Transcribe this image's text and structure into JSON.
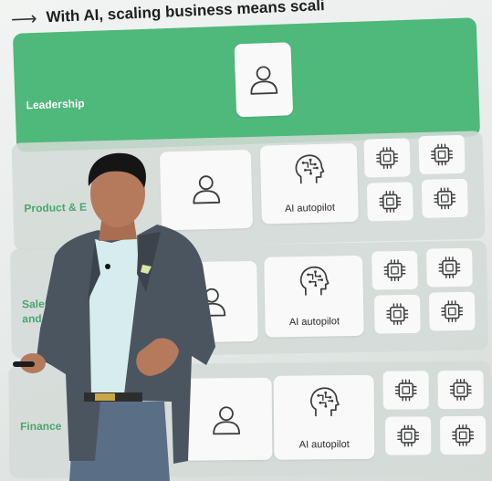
{
  "slide": {
    "headline": "With AI, scaling business means scali",
    "arrow_glyph": "⟶",
    "rows": [
      {
        "label": "Leadership"
      },
      {
        "label": "Product & E"
      },
      {
        "label_line1": "Sales",
        "label_line2": "and r"
      },
      {
        "label": "Finance"
      }
    ],
    "ai_label": "AI autopilot"
  },
  "icons": {
    "person": "person-outline-icon",
    "brain": "brain-circuit-icon",
    "chip": "microchip-icon"
  },
  "colors": {
    "accent_green": "#4fb87b",
    "label_green": "#4aa571",
    "row_gray": "#d3dbd7",
    "blazer": "#4a5560",
    "shirt": "#d7ecef"
  }
}
